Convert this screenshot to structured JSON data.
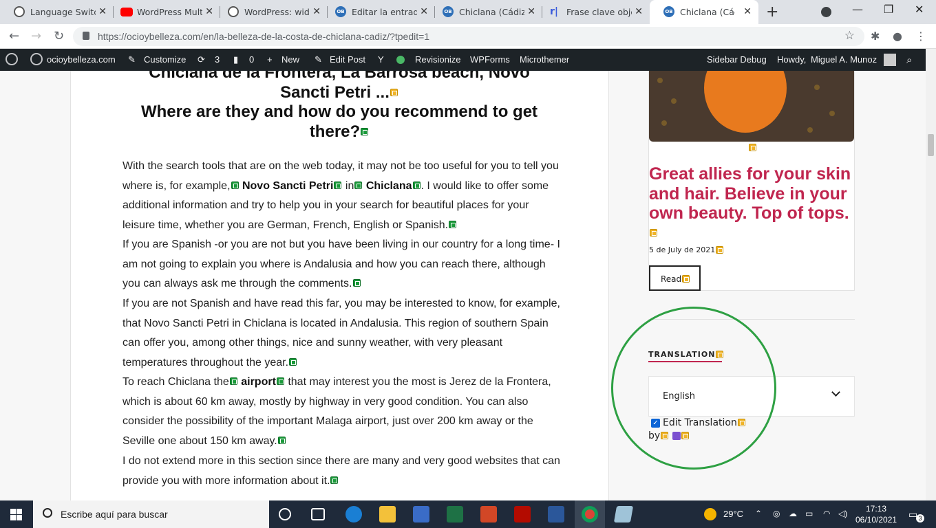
{
  "browser": {
    "tabs": [
      {
        "label": "Language Switcher",
        "icon": "wordpress-icon"
      },
      {
        "label": "WordPress Multilingual",
        "icon": "youtube-icon"
      },
      {
        "label": "WordPress: widgets",
        "icon": "wordpress-icon"
      },
      {
        "label": "Editar la entrada",
        "icon": "ob-icon"
      },
      {
        "label": "Chiclana (Cádiz)",
        "icon": "ob-icon"
      },
      {
        "label": "Frase clave objetivo",
        "icon": "rankmath-icon"
      },
      {
        "label": "Chiclana (Cádiz)",
        "icon": "ob-icon",
        "active": true
      }
    ],
    "url": "https://ocioybelleza.com/en/la-belleza-de-la-costa-de-chiclana-cadiz/?tpedit=1"
  },
  "adminbar": {
    "site": "ocioybelleza.com",
    "customize": "Customize",
    "updates": "3",
    "comments": "0",
    "new": "New",
    "edit_post": "Edit Post",
    "revisionize": "Revisionize",
    "wpforms": "WPForms",
    "microthemer": "Microthemer",
    "sidebar_debug": "Sidebar Debug",
    "howdy": "Howdy,",
    "user": "Miguel A. Munoz"
  },
  "article": {
    "heading_line1": "Chiclana de la Frontera, La Barrosa beach, Novo",
    "heading_line2": "Sancti Petri ...",
    "heading_line3": "Where are they and how do you recommend to get",
    "heading_line4": "there?",
    "p1_a": "With the search tools that are on the web today, it may not be too useful for you to tell you where is, for example,",
    "p1_b1": "Novo Sancti Petri",
    "p1_in": " in",
    "p1_b2": "Chiclana",
    "p1_c": ". I would like to offer some additional information and try to help you in your search for beautiful places for your leisure time, whether you are German, French, English or Spanish.",
    "p2": "If you are Spanish -or you are not but you have been living in our country for a long time- I am not going to explain you where is Andalusia and how you can reach there, although you can always ask me through the comments.",
    "p3": "If you are not Spanish and have read this far, you may be interested to know, for example, that Novo Sancti Petri in Chiclana is located in Andalusia. This region of southern Spain can offer you, among other things, nice and sunny weather, with very pleasant temperatures throughout the year.",
    "p4_a": "To reach Chiclana the",
    "p4_b": "airport",
    "p4_c": " that may interest you the most is Jerez de la Frontera, which is about 60 km away, mostly by highway in very good condition. You can also consider the possibility of the important Malaga airport, just over 200 km away or the Seville one about 150 km away.",
    "p5": "I do not extend more in this section since there are many and very good websites that can provide you with more information about it."
  },
  "sidebar": {
    "card_title": "Great allies for your skin and hair. Believe in your own beauty. Top of tops.",
    "card_date": "5 de July de 2021",
    "read_label": "Read",
    "translation_title": "TRANSLATION",
    "language": "English",
    "edit_translation": "Edit Translation",
    "by": "by"
  },
  "taskbar": {
    "search_placeholder": "Escribe aquí para buscar",
    "temperature": "29°C",
    "time": "17:13",
    "date": "06/10/2021",
    "notifications": "3"
  },
  "colors": {
    "accent": "#c0264f",
    "admin_bar": "#1d2327",
    "highlight_circle": "#2ea043"
  }
}
